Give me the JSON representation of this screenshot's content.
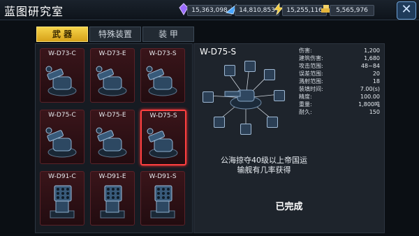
{
  "header": {
    "title": "蓝图研究室",
    "resources": [
      {
        "icon": "crystal-icon",
        "value": "15,363,098",
        "color": "#9b6cff"
      },
      {
        "icon": "fuel-icon",
        "value": "14,810,853",
        "color": "#49a6ff"
      },
      {
        "icon": "energy-icon",
        "value": "15,255,116",
        "color": "#f1c93b"
      },
      {
        "icon": "gold-icon",
        "value": "5,565,976",
        "color": "#e3b43b"
      }
    ]
  },
  "tabs": [
    {
      "label": "武 器",
      "active": true
    },
    {
      "label": "特殊装置",
      "active": false
    },
    {
      "label": "装 甲",
      "active": false
    }
  ],
  "blueprints": [
    {
      "label": "W-D73-C",
      "kind": "cannon",
      "selected": false
    },
    {
      "label": "W-D73-E",
      "kind": "cannon",
      "selected": false
    },
    {
      "label": "W-D73-S",
      "kind": "cannon",
      "selected": false
    },
    {
      "label": "W-D75-C",
      "kind": "cannon",
      "selected": false
    },
    {
      "label": "W-D75-E",
      "kind": "cannon",
      "selected": false
    },
    {
      "label": "W-D75-S",
      "kind": "cannon",
      "selected": true
    },
    {
      "label": "W-D91-C",
      "kind": "launcher",
      "selected": false
    },
    {
      "label": "W-D91-E",
      "kind": "launcher",
      "selected": false
    },
    {
      "label": "W-D91-S",
      "kind": "launcher",
      "selected": false
    }
  ],
  "detail": {
    "name": "W-D75-S",
    "stats": [
      {
        "k": "伤害:",
        "v": "1,200"
      },
      {
        "k": "建筑伤害:",
        "v": "1,680"
      },
      {
        "k": "攻击范围:",
        "v": "48~84"
      },
      {
        "k": "误差范围:",
        "v": "20"
      },
      {
        "k": "溅射范围:",
        "v": "18"
      },
      {
        "k": "装填时间:",
        "v": "7.00(s)"
      },
      {
        "k": "精度:",
        "v": "100.00"
      },
      {
        "k": "重量:",
        "v": "1,800吨"
      },
      {
        "k": "耐久:",
        "v": "150"
      }
    ],
    "note_line1": "公海掠夺40级以上帝国运",
    "note_line2": "输舰有几率获得",
    "status": "已完成"
  }
}
